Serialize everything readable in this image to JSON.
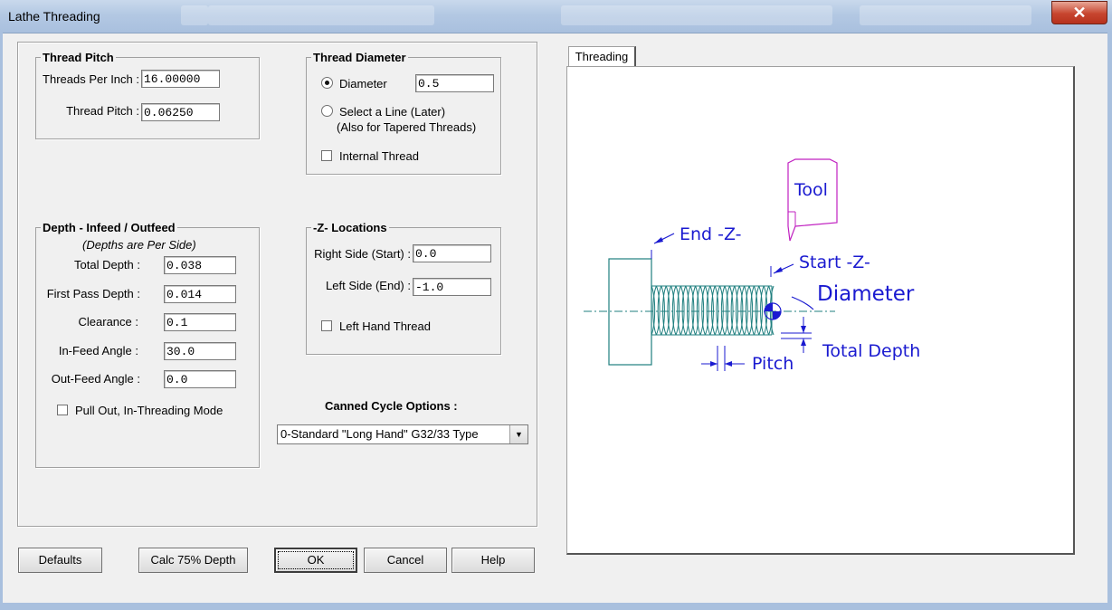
{
  "window": {
    "title": "Lathe Threading",
    "close_glyph": "✕"
  },
  "thread_pitch": {
    "title": "Thread Pitch",
    "tpi_label": "Threads Per Inch :",
    "tpi_value": "16.00000",
    "pitch_label": "Thread Pitch :",
    "pitch_value": "0.06250"
  },
  "thread_diameter": {
    "title": "Thread Diameter",
    "diameter_label": "Diameter",
    "diameter_value": "0.5",
    "diameter_selected": true,
    "select_line_label": "Select a Line (Later)",
    "select_line_sub": "(Also for Tapered Threads)",
    "internal_label": "Internal Thread",
    "internal_checked": false
  },
  "depth": {
    "title": "Depth - Infeed / Outfeed",
    "subtitle": "(Depths are Per Side)",
    "total_label": "Total Depth :",
    "total_value": "0.038",
    "first_label": "First Pass Depth :",
    "first_value": "0.014",
    "clearance_label": "Clearance :",
    "clearance_value": "0.1",
    "infeed_label": "In-Feed Angle :",
    "infeed_value": "30.0",
    "outfeed_label": "Out-Feed Angle :",
    "outfeed_value": "0.0",
    "pullout_label": "Pull Out, In-Threading Mode",
    "pullout_checked": false
  },
  "z_locations": {
    "title": "-Z- Locations",
    "right_label": "Right Side (Start) :",
    "right_value": "0.0",
    "left_label": "Left Side (End) :",
    "left_value": "-1.0",
    "lefthand_label": "Left Hand Thread",
    "lefthand_checked": false
  },
  "canned": {
    "label": "Canned Cycle Options :",
    "selected": "0-Standard \"Long Hand\" G32/33 Type"
  },
  "buttons": {
    "defaults": "Defaults",
    "calc": "Calc 75% Depth",
    "ok": "OK",
    "cancel": "Cancel",
    "help": "Help"
  },
  "tab": {
    "label": "Threading"
  },
  "diagram": {
    "tool": "Tool",
    "end_z": "End -Z-",
    "start_z": "Start -Z-",
    "diameter": "Diameter",
    "total_depth": "Total Depth",
    "pitch": "Pitch"
  },
  "colors": {
    "label_blue": "#1a1ad0",
    "part_teal": "#1f7f7f",
    "tool_magenta": "#c020c0",
    "titlebar": "#b8cbe4",
    "close_red": "#c7452f"
  }
}
